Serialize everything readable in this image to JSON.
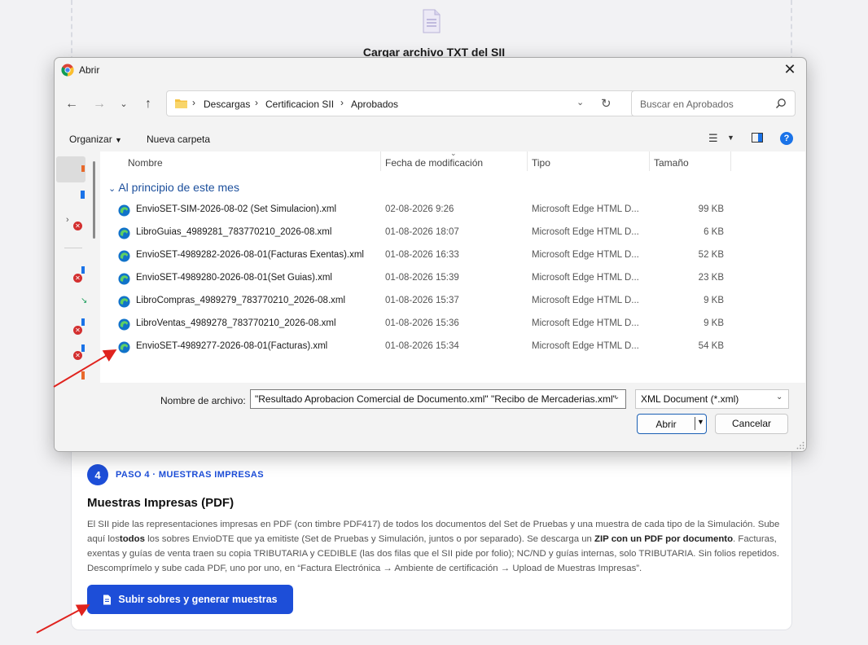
{
  "page": {
    "upload_title": "Cargar archivo TXT del SII",
    "step_number": "4",
    "step_label": "PASO 4 · MUESTRAS IMPRESAS",
    "card_title": "Muestras Impresas (PDF)",
    "desc": {
      "p1": "El SII pide las representaciones impresas en PDF (con timbre PDF417) de todos los documentos del Set de Pruebas y una muestra de cada tipo de la Simulación. Sube aquí los",
      "b1": "todos",
      "p2": " los sobres EnvioDTE que ya emitiste (Set de Pruebas y Simulación, juntos o por separado). Se descarga un ",
      "b2": "ZIP con un PDF por documento",
      "p3": ". Facturas, exentas y guías de venta traen su copia TRIBUTARIA y CEDIBLE (las dos filas que el SII pide por folio); NC/ND y guías internas, solo TRIBUTARIA. Sin folios repetidos. Descomprímelo y sube cada PDF, uno por uno, en “Factura Electrónica → Ambiente de certificación → Upload de Muestras Impresas”."
    },
    "primary_button": "Subir sobres y generar muestras"
  },
  "dialog": {
    "title": "Abrir",
    "breadcrumbs": [
      "Descargas",
      "Certificacion SII",
      "Aprobados"
    ],
    "search_placeholder": "Buscar en Aprobados",
    "organize": "Organizar",
    "new_folder": "Nueva carpeta",
    "columns": {
      "name": "Nombre",
      "date": "Fecha de modificación",
      "type": "Tipo",
      "size": "Tamaño"
    },
    "group": "Al principio de este mes",
    "files": [
      {
        "name": "EnvioSET-SIM-2026-08-02 (Set Simulacion).xml",
        "date": "02-08-2026 9:26",
        "type": "Microsoft Edge HTML D...",
        "size": "99 KB"
      },
      {
        "name": "LibroGuias_4989281_783770210_2026-08.xml",
        "date": "01-08-2026 18:07",
        "type": "Microsoft Edge HTML D...",
        "size": "6 KB"
      },
      {
        "name": "EnvioSET-4989282-2026-08-01(Facturas Exentas).xml",
        "date": "01-08-2026 16:33",
        "type": "Microsoft Edge HTML D...",
        "size": "52 KB"
      },
      {
        "name": "EnvioSET-4989280-2026-08-01(Set Guias).xml",
        "date": "01-08-2026 15:39",
        "type": "Microsoft Edge HTML D...",
        "size": "23 KB"
      },
      {
        "name": "LibroCompras_4989279_783770210_2026-08.xml",
        "date": "01-08-2026 15:37",
        "type": "Microsoft Edge HTML D...",
        "size": "9 KB"
      },
      {
        "name": "LibroVentas_4989278_783770210_2026-08.xml",
        "date": "01-08-2026 15:36",
        "type": "Microsoft Edge HTML D...",
        "size": "9 KB"
      },
      {
        "name": "EnvioSET-4989277-2026-08-01(Facturas).xml",
        "date": "01-08-2026 15:34",
        "type": "Microsoft Edge HTML D...",
        "size": "54 KB"
      }
    ],
    "filename_label": "Nombre de archivo:",
    "filename_value": "\"Resultado Aprobacion Comercial de Documento.xml\" \"Recibo de Mercaderias.xml\"",
    "filetype": "XML Document (*.xml)",
    "open": "Abrir",
    "cancel": "Cancelar"
  },
  "colors": {
    "accent": "#1d4ed8",
    "group_heading": "#1c4f9c",
    "arrow": "#e0231e"
  }
}
